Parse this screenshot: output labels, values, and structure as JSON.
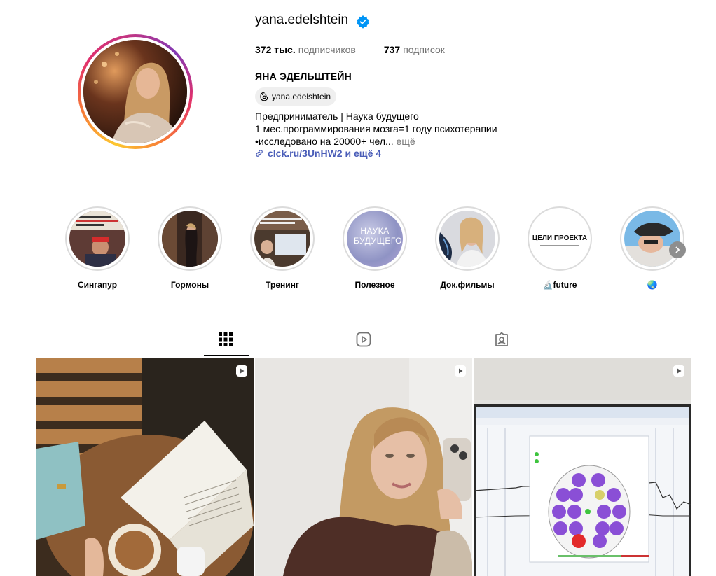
{
  "profile": {
    "username": "yana.edelshtein",
    "followers_count": "372 тыс.",
    "followers_label": "подписчиков",
    "following_count": "737",
    "following_label": "подписок",
    "full_name": "ЯНА ЭДЕЛЬШТЕЙН",
    "threads_handle": "yana.edelshtein",
    "bio_line1": "Предприниматель | Наука будущего",
    "bio_line2": "1 мес.программирования мозга=1 году психотерапии",
    "bio_line3": "•исследовано на 20000+ чел...",
    "bio_more": "ещё",
    "link_text": "clck.ru/3UnHW2 и ещё 4"
  },
  "highlights": [
    {
      "label": "Сингапур"
    },
    {
      "label": "Гормоны"
    },
    {
      "label": "Тренинг"
    },
    {
      "label": "Полезное",
      "cover_text": "НАУКА БУДУЩЕГО"
    },
    {
      "label": "Док.фильмы"
    },
    {
      "label": "🔬future",
      "cover_text": "ЦЕЛИ ПРОЕКТА"
    },
    {
      "label": "🌏"
    }
  ],
  "tabs": [
    {
      "icon": "grid-icon",
      "active": true
    },
    {
      "icon": "reels-icon",
      "active": false
    },
    {
      "icon": "tagged-icon",
      "active": false
    }
  ],
  "colors": {
    "link": "#4a5db8",
    "muted": "#737373",
    "verified": "#0095f6"
  }
}
